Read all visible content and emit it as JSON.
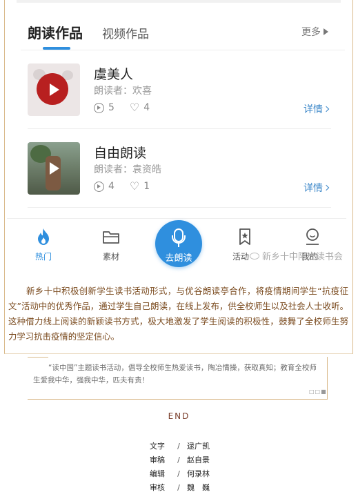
{
  "tabs": {
    "active": "朗读作品",
    "other": "视频作品",
    "more": "更多"
  },
  "works": [
    {
      "title": "虞美人",
      "reader": "朗读者：欢喜",
      "plays": "5",
      "likes": "4",
      "detail": "详情"
    },
    {
      "title": "自由朗读",
      "reader": "朗读者：袁资皓",
      "plays": "4",
      "likes": "1",
      "detail": "详情"
    }
  ],
  "nav": {
    "hot": "热门",
    "material": "素材",
    "read": "去朗读",
    "activity": "活动",
    "mine": "我的"
  },
  "watermark": "新乡十中阳光读书会",
  "paragraph": "新乡十中积极创新学生读书活动形式，与优谷朗读亭合作，将疫情期间学生“抗疫征文”活动中的优秀作品，通过学生自己朗读，在线上发布，供全校师生以及社会人士收听。这种借力线上阅读的新颖读书方式，极大地激发了学生阅读的积极性，鼓舞了全校师生努力学习抗击疫情的坚定信心。",
  "quote": "“读中国”主题读书活动，倡导全校师生热爱读书，陶冶情操，获取真知；教育全校师生爱我中华，强我中华，匹夫有责！",
  "end": "END",
  "credits": [
    {
      "role": "文字",
      "sep": "/",
      "name": "逯广凯"
    },
    {
      "role": "审稿",
      "sep": "/",
      "name": "赵自景"
    },
    {
      "role": "编辑",
      "sep": "/",
      "name": "何录林"
    },
    {
      "role": "审核",
      "sep": "/",
      "name": "魏　巍"
    }
  ],
  "colors": {
    "accent": "#2f8fde",
    "link": "#3a86c8",
    "paragraph": "#7a4a1e",
    "frame": "#d9b98a"
  }
}
